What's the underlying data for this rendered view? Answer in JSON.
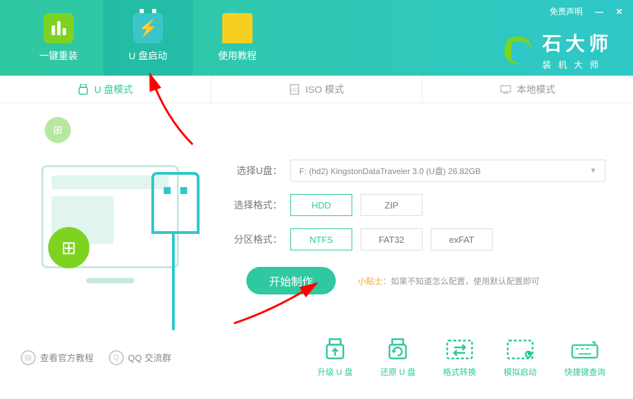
{
  "header": {
    "nav": [
      {
        "label": "一键重装"
      },
      {
        "label": "U 盘启动"
      },
      {
        "label": "使用教程"
      }
    ],
    "disclaimer": "免责声明",
    "logo": {
      "main": "石大师",
      "sub": "装机大师"
    }
  },
  "modes": {
    "usb": "U 盘模式",
    "iso": "ISO 模式",
    "local": "本地模式"
  },
  "form": {
    "select_usb_label": "选择U盘：",
    "select_usb_value": "F: (hd2) KingstonDataTraveler 3.0 (U盘) 26.82GB",
    "format_label": "选择格式：",
    "format_options": [
      "HDD",
      "ZIP"
    ],
    "partition_label": "分区格式：",
    "partition_options": [
      "NTFS",
      "FAT32",
      "exFAT"
    ],
    "start_button": "开始制作",
    "tip_label": "小贴士：",
    "tip_text": "如果不知道怎么配置，使用默认配置即可"
  },
  "footer": {
    "official_tutorial": "查看官方教程",
    "qq_group": "QQ 交流群",
    "tools": {
      "upgrade": "升级 U 盘",
      "restore": "还原 U 盘",
      "convert": "格式转换",
      "simulate": "模拟启动",
      "shortcut": "快捷键查询"
    }
  }
}
